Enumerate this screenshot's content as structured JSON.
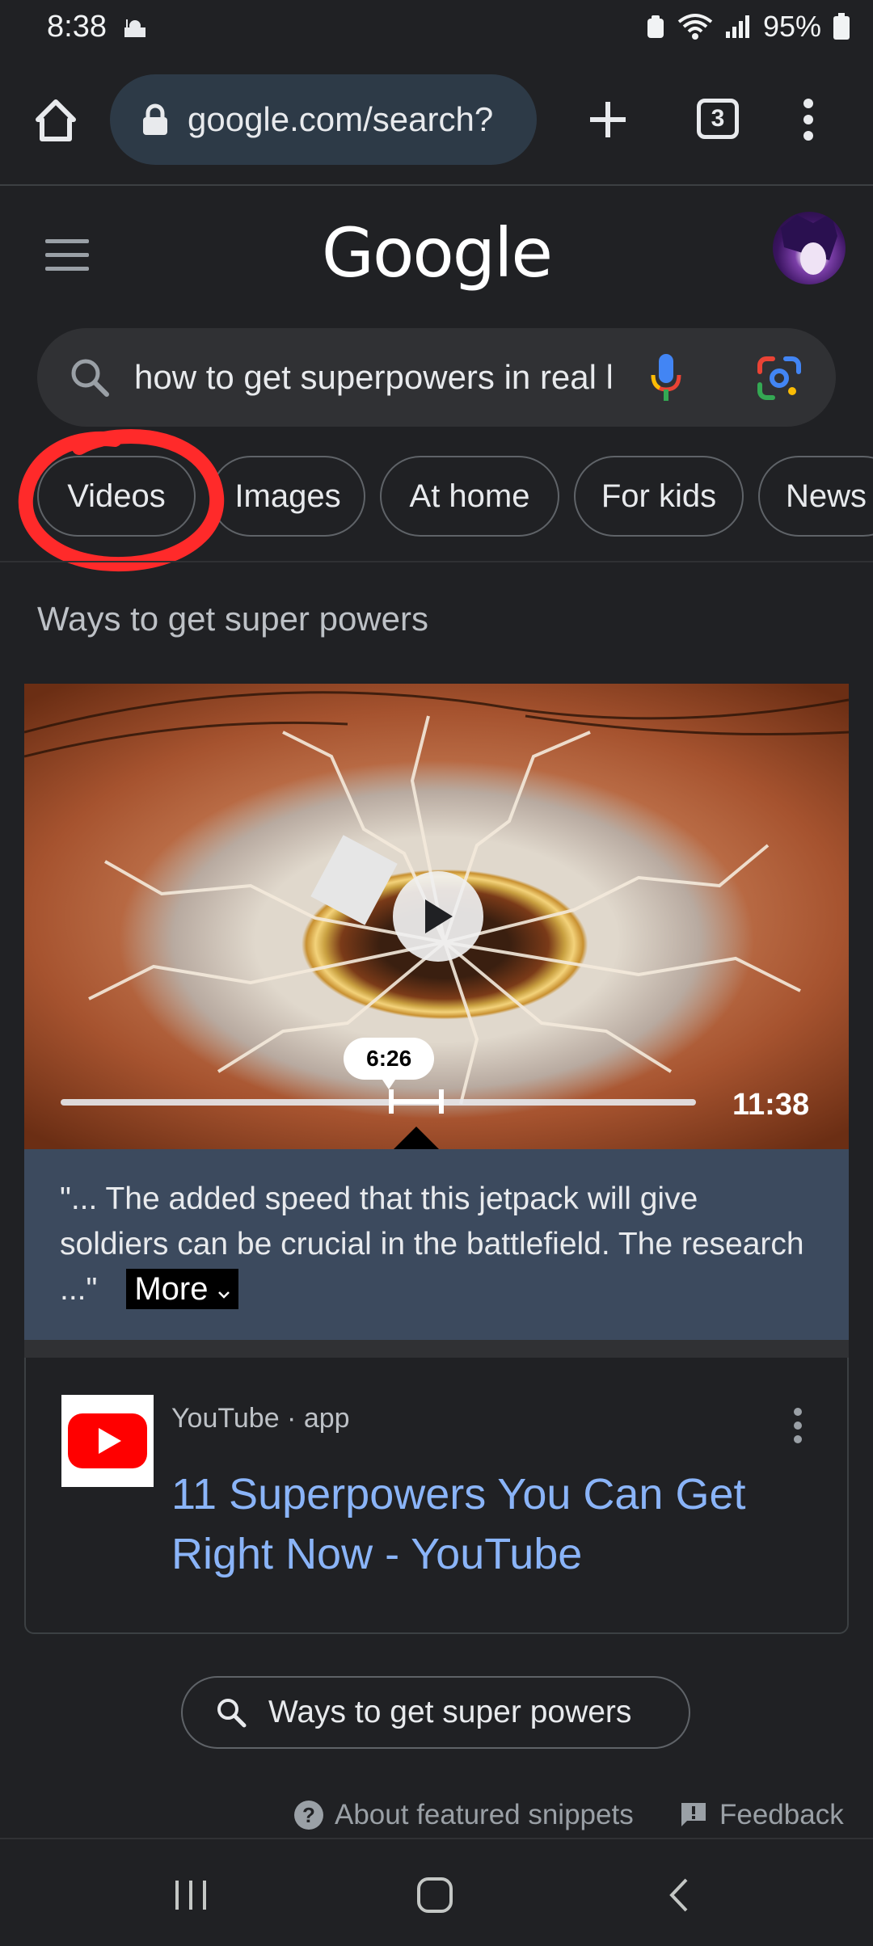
{
  "status_bar": {
    "time": "8:38",
    "battery": "95%"
  },
  "browser": {
    "url": "google.com/search?",
    "tab_count": "3"
  },
  "google": {
    "logo": "Google"
  },
  "search": {
    "query": "how to get superpowers in real life"
  },
  "chips": [
    "Videos",
    "Images",
    "At home",
    "For kids",
    "News"
  ],
  "snippet": {
    "heading": "Ways to get super powers",
    "video": {
      "timestamp": "6:26",
      "duration": "11:38",
      "progress": 0.56
    },
    "transcript": "\"... The added speed that this jetpack will give soldiers can be crucial in the battlefield. The research ...\"",
    "more_label": "More"
  },
  "result": {
    "source": "YouTube · app",
    "title": "11 Superpowers You Can Get Right Now - YouTube"
  },
  "related_search": "Ways to get super powers",
  "footer": {
    "about": "About featured snippets",
    "feedback": "Feedback"
  },
  "colors": {
    "link": "#8ab4f8",
    "background": "#202124",
    "annotation": "#ff2a2a"
  },
  "icons": [
    "home-icon",
    "lock-icon",
    "new-tab-icon",
    "overflow-menu-icon",
    "hamburger-menu-icon",
    "search-icon",
    "microphone-icon",
    "google-lens-icon",
    "play-icon",
    "youtube-icon",
    "help-icon",
    "feedback-icon",
    "recents-icon",
    "home-nav-icon",
    "back-icon"
  ]
}
